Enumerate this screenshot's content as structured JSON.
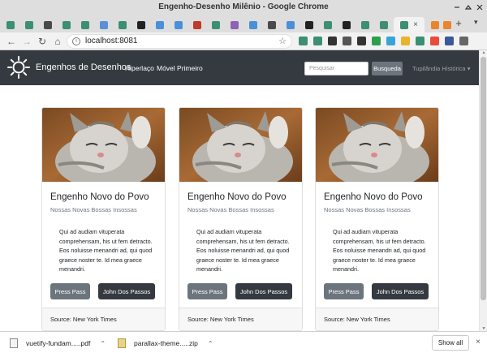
{
  "window": {
    "title": "Engenho-Desenho Milênio - Google Chrome"
  },
  "tabs": {
    "favicons": [
      "#3c8f72",
      "#3c8f72",
      "#4a4a4a",
      "#3c8f72",
      "#3c8f72",
      "#5b8fd6",
      "#3c8f72",
      "#222222",
      "#4a90d9",
      "#4a90d9",
      "#c0392b",
      "#3c8f72",
      "#8e62b5",
      "#4a90d9",
      "#4a4a4a",
      "#4a90d9",
      "#222222",
      "#3c8f72",
      "#222222",
      "#3c8f72",
      "#3c8f72",
      "#3c8f72",
      "#e8852e",
      "#e8852e"
    ],
    "active_close": "×",
    "new_tab": "+"
  },
  "toolbar": {
    "back": "←",
    "forward": "→",
    "reload": "↻",
    "home": "⌂",
    "url": "localhost:8081",
    "star": "☆",
    "extensions": [
      "#3c8f72",
      "#3c8f72",
      "#333333",
      "#555555",
      "#333333",
      "#2e9e4d",
      "#3aa3d8",
      "#e8b32e",
      "#3c8f72",
      "#e74c3c",
      "#3b5998",
      "#666666"
    ]
  },
  "navbar": {
    "brand": "Engenhos de Desenhos",
    "links": [
      "Hiperlaço",
      "Móvel Primeiro"
    ],
    "search_placeholder": "Pesquisar",
    "search_button": "Busqueda",
    "dropdown": "Tupilândia Histórica"
  },
  "cards": [
    {
      "title": "Engenho Novo do Povo",
      "subtitle": "Nossas Novas Bossas Insossas",
      "text": "Qui ad audiam vituperata comprehensam, his ut fem detracto. Eos noluisse menandri ad, qui quod graece noster te. Id mea graece menandri.",
      "button_primary": "Press Pass",
      "button_secondary": "John Dos Passos",
      "footer": "Source: New York Times"
    },
    {
      "title": "Engenho Novo do Povo",
      "subtitle": "Nossas Novas Bossas Insossas",
      "text": "Qui ad audiam vituperata comprehensam, his ut fem detracto. Eos noluisse menandri ad, qui quod graece noster te. Id mea graece menandri.",
      "button_primary": "Press Pass",
      "button_secondary": "John Dos Passos",
      "footer": "Source: New York Times"
    },
    {
      "title": "Engenho Novo do Povo",
      "subtitle": "Nossas Novas Bossas Insossas",
      "text": "Qui ad audiam vituperata comprehensam, his ut fem detracto. Eos noluisse menandri ad, qui quod graece noster te. Id mea graece menandri.",
      "button_primary": "Press Pass",
      "button_secondary": "John Dos Passos",
      "footer": "Source: New York Times"
    }
  ],
  "downloads": {
    "items": [
      {
        "name": "vuetify-fundam.....pdf",
        "type": "pdf"
      },
      {
        "name": "parallax-theme.....zip",
        "type": "zip"
      }
    ],
    "show_all": "Show all",
    "close": "×"
  },
  "colors": {
    "navbar": "#343a40",
    "secondary_button": "#6c757d",
    "dark_button": "#343a40",
    "card_border": "#dfdfdf"
  }
}
